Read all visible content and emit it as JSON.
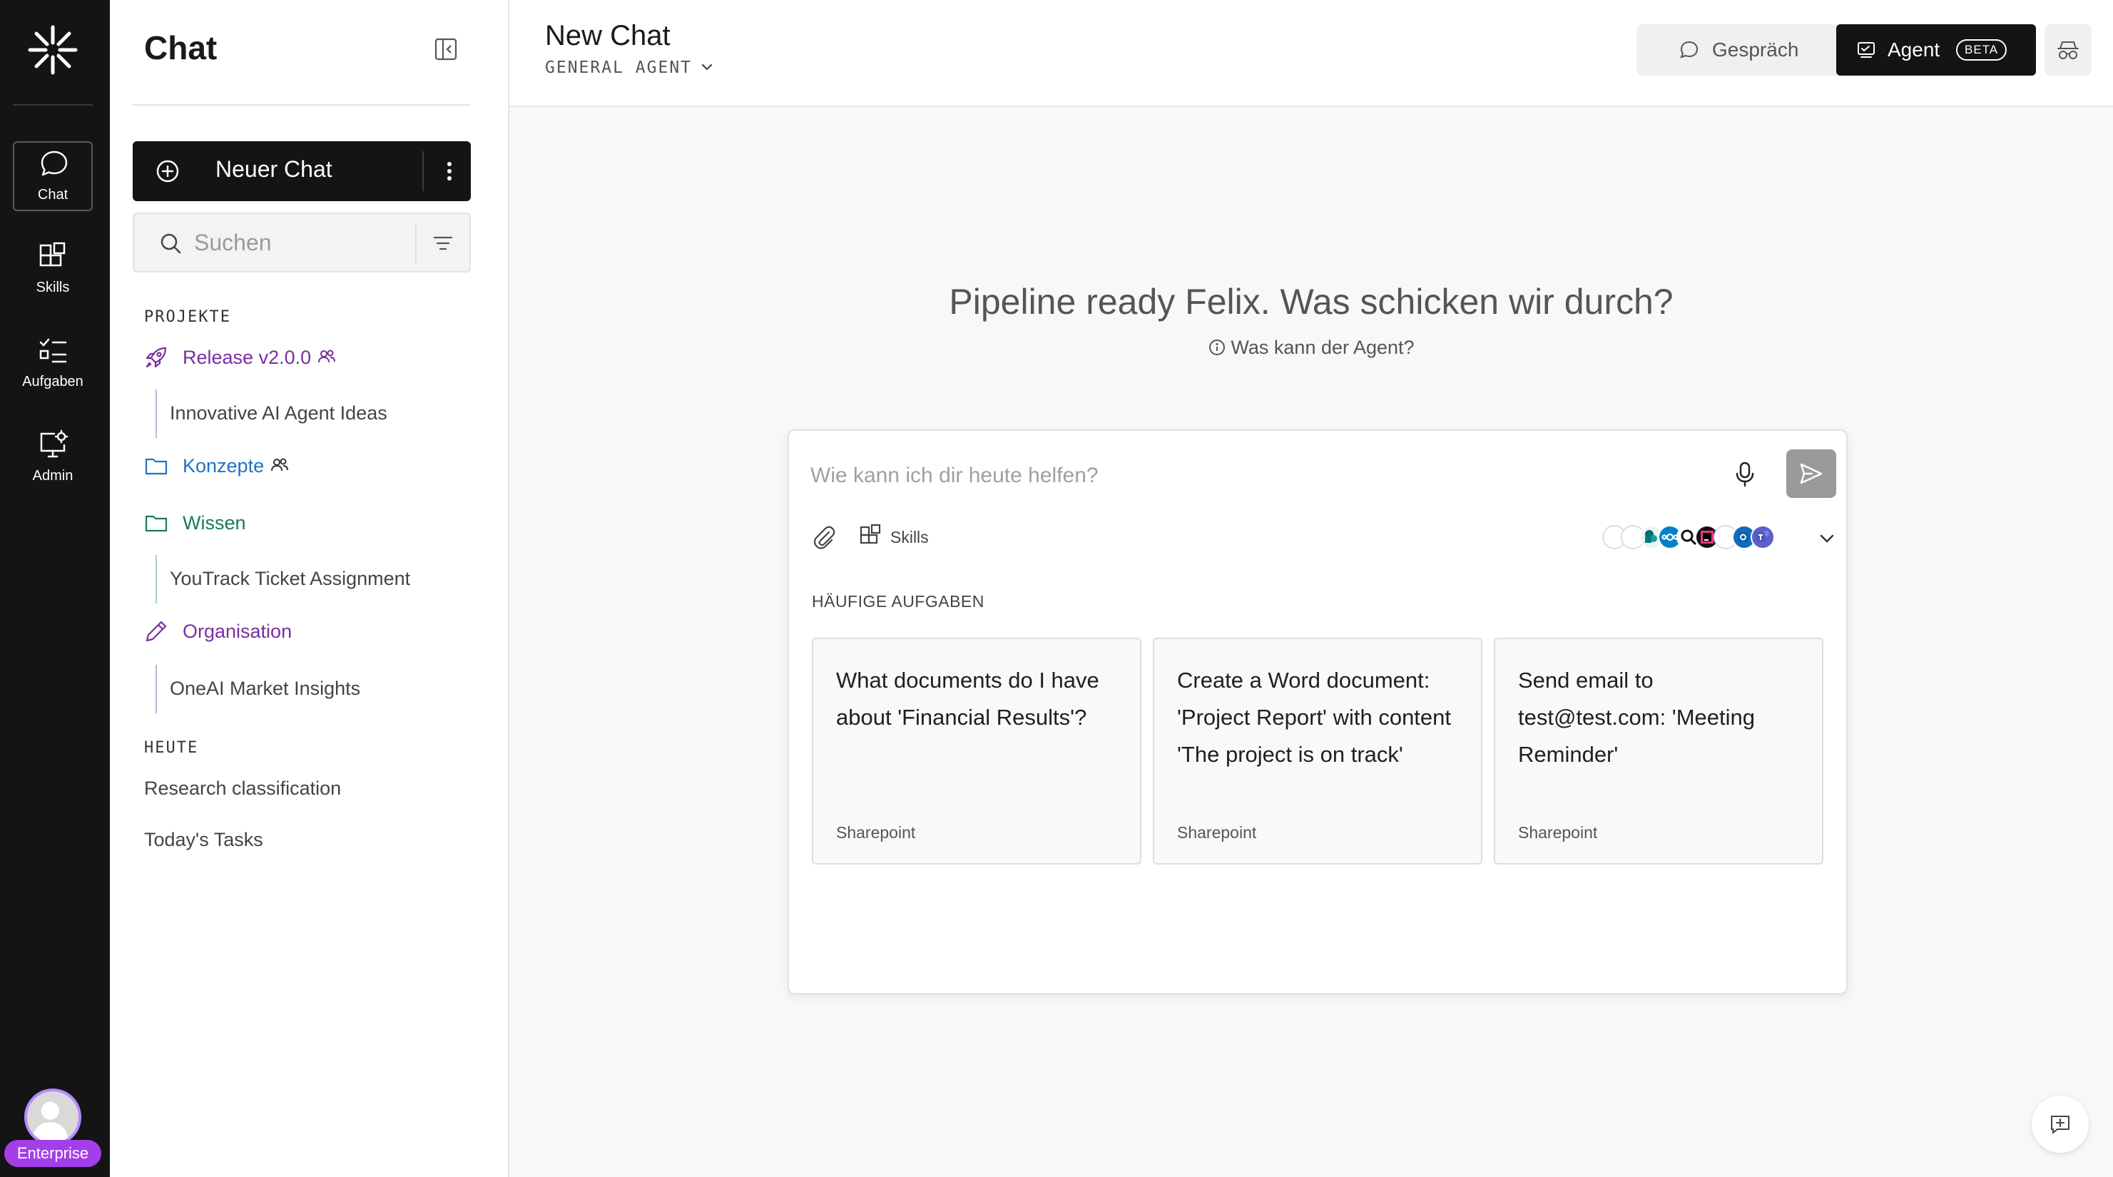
{
  "rail": {
    "items": [
      {
        "label": "Chat",
        "icon": "chat-bubble-icon",
        "active": true
      },
      {
        "label": "Skills",
        "icon": "skills-grid-icon",
        "active": false
      },
      {
        "label": "Aufgaben",
        "icon": "checklist-icon",
        "active": false
      },
      {
        "label": "Admin",
        "icon": "monitor-gear-icon",
        "active": false
      }
    ],
    "badge": "Enterprise"
  },
  "sidebar": {
    "title": "Chat",
    "new_chat_label": "Neuer Chat",
    "search_placeholder": "Suchen",
    "projects_heading": "PROJEKTE",
    "projects": [
      {
        "label": "Release v2.0.0",
        "icon": "rocket-icon",
        "color": "#7a2fa0",
        "shared": true
      },
      {
        "label": "Innovative AI Agent Ideas",
        "sub": true
      },
      {
        "label": "Konzepte",
        "icon": "folder-icon",
        "color": "#1f73c2",
        "shared": true
      },
      {
        "label": "Wissen",
        "icon": "folder-icon",
        "color": "#1a7a5a",
        "shared": false
      },
      {
        "label": "YouTrack Ticket Assignment",
        "sub": true
      },
      {
        "label": "Organisation",
        "icon": "pencil-icon",
        "color": "#7a2fa0",
        "shared": false
      },
      {
        "label": "OneAI Market Insights",
        "sub": true
      }
    ],
    "today_heading": "HEUTE",
    "history": [
      "Research classification",
      "Today's Tasks"
    ]
  },
  "header": {
    "title": "New Chat",
    "agent": "GENERAL AGENT",
    "mode_conversation": "Gespräch",
    "mode_agent": "Agent",
    "beta": "BETA"
  },
  "main": {
    "greeting": "Pipeline ready Felix. Was schicken wir durch?",
    "info_link": "Was kann der Agent?",
    "composer": {
      "placeholder": "Wie kann ich dir heute helfen?",
      "skills_label": "Skills",
      "section": "HÄUFIGE AUFGABEN",
      "tasks": [
        {
          "text": "What documents do I have about 'Financial Results'?",
          "source": "Sharepoint"
        },
        {
          "text": "Create a Word document: 'Project Report' with content 'The project is on track'",
          "source": "Sharepoint"
        },
        {
          "text": "Send email to test@test.com: 'Meeting Reminder'",
          "source": "Sharepoint"
        }
      ]
    }
  },
  "colors": {
    "rail_bg": "#141414",
    "primary_button": "#141414",
    "enterprise_badge": "#a33ee8",
    "send_button": "#9a9a9a"
  }
}
